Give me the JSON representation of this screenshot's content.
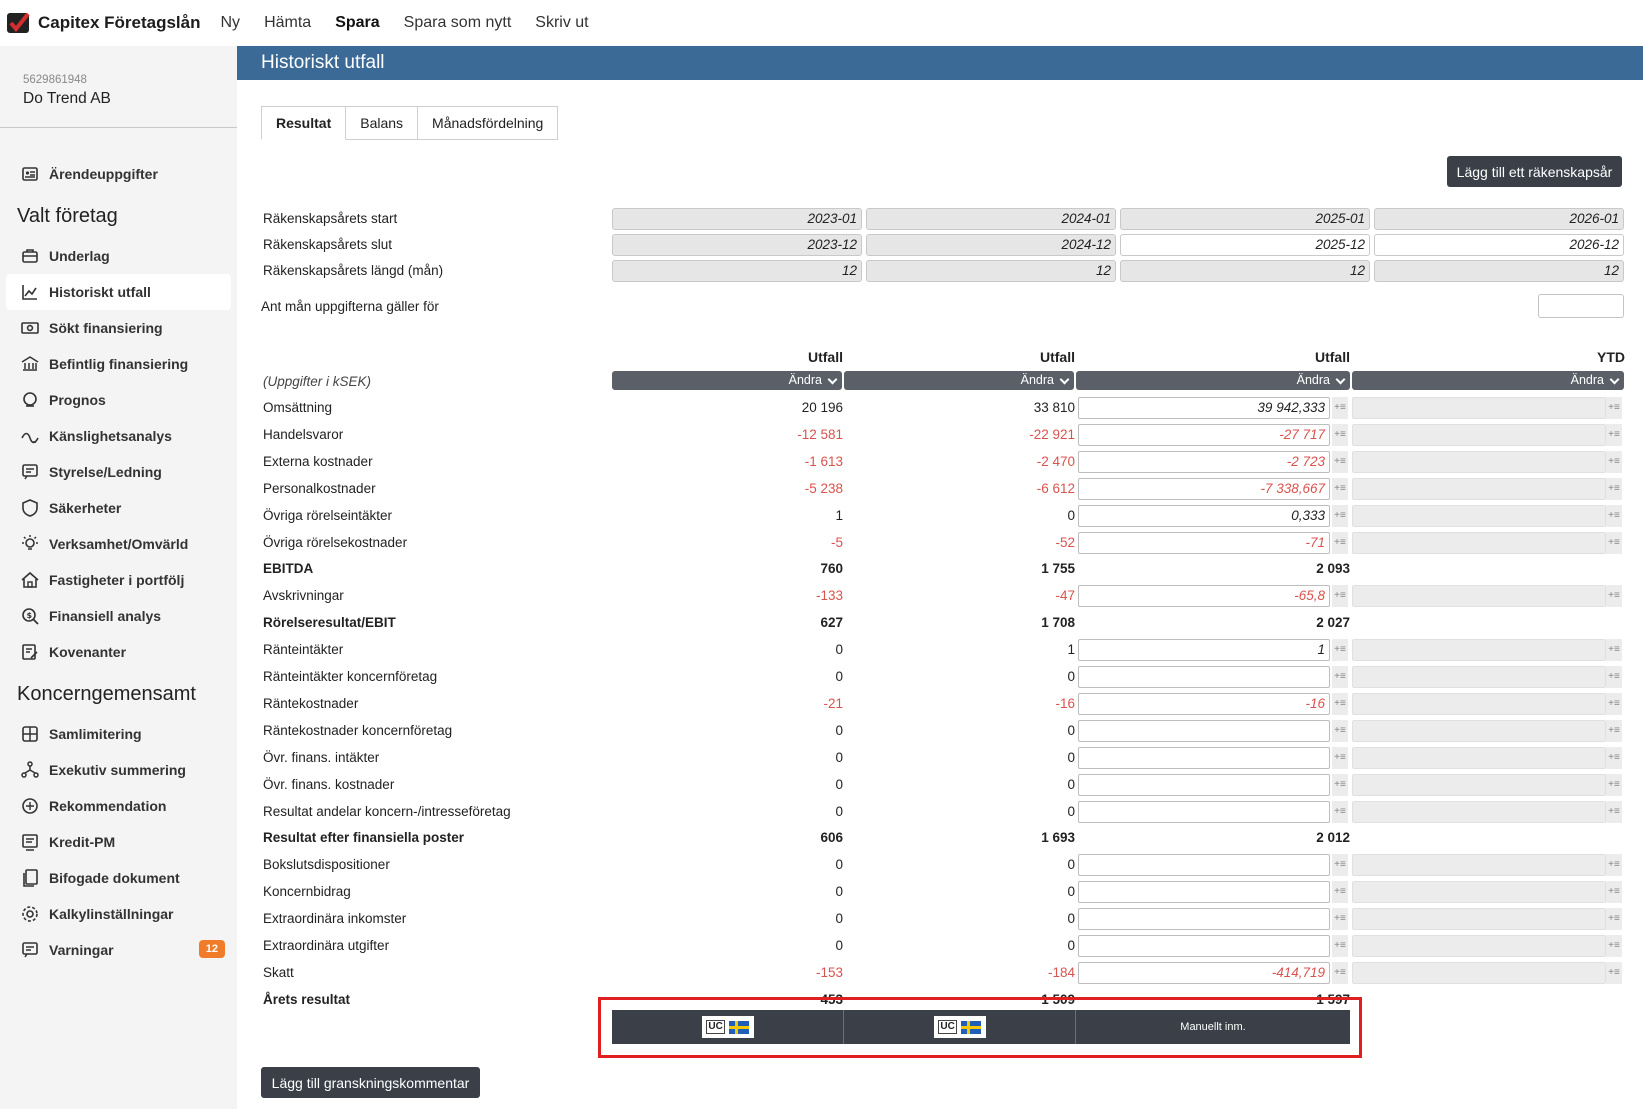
{
  "app": {
    "title": "Capitex Företagslån"
  },
  "topnav": [
    "Ny",
    "Hämta",
    "Spara",
    "Spara som nytt",
    "Skriv ut"
  ],
  "company": {
    "orgnr": "5629861948",
    "name": "Do Trend AB"
  },
  "sidebar": {
    "top_item": "Ärendeuppgifter",
    "section1": "Valt företag",
    "items1": [
      "Underlag",
      "Historiskt utfall",
      "Sökt finansiering",
      "Befintlig finansiering",
      "Prognos",
      "Känslighetsanalys",
      "Styrelse/Ledning",
      "Säkerheter",
      "Verksamhet/Omvärld",
      "Fastigheter i portfölj",
      "Finansiell analys",
      "Kovenanter"
    ],
    "section2": "Koncerngemensamt",
    "items2": [
      "Samlimitering",
      "Exekutiv summering",
      "Rekommendation",
      "Kredit-PM",
      "Bifogade dokument",
      "Kalkylinställningar",
      "Varningar"
    ],
    "warnings_count": "12"
  },
  "page": {
    "title": "Historiskt utfall",
    "tabs": [
      "Resultat",
      "Balans",
      "Månadsfördelning"
    ],
    "add_year_button": "Lägg till ett räkenskapsår",
    "add_comment_button": "Lägg till granskningskommentar",
    "months_label": "Ant mån uppgifterna gäller för",
    "units_label": "(Uppgifter i kSEK)",
    "change_label": "Ändra",
    "manual_label": "Manuellt inm."
  },
  "period": {
    "labels": [
      "Räkenskapsårets start",
      "Räkenskapsårets slut",
      "Räkenskapsårets längd (mån)"
    ],
    "start": [
      "2023-01",
      "2024-01",
      "2025-01",
      "2026-01"
    ],
    "end": [
      "2023-12",
      "2024-12",
      "2025-12",
      "2026-12"
    ],
    "length": [
      "12",
      "12",
      "12",
      "12"
    ]
  },
  "columns": [
    "Utfall",
    "Utfall",
    "Utfall",
    "YTD"
  ],
  "rows": [
    {
      "label": "Omsättning",
      "bold": false,
      "v": [
        "20 196",
        "33 810",
        "39 942,333"
      ]
    },
    {
      "label": "Handelsvaror",
      "bold": false,
      "v": [
        "-12 581",
        "-22 921",
        "-27 717"
      ]
    },
    {
      "label": "Externa kostnader",
      "bold": false,
      "v": [
        "-1 613",
        "-2 470",
        "-2 723"
      ]
    },
    {
      "label": "Personalkostnader",
      "bold": false,
      "v": [
        "-5 238",
        "-6 612",
        "-7 338,667"
      ]
    },
    {
      "label": "Övriga rörelseintäkter",
      "bold": false,
      "v": [
        "1",
        "0",
        "0,333"
      ]
    },
    {
      "label": "Övriga rörelsekostnader",
      "bold": false,
      "v": [
        "-5",
        "-52",
        "-71"
      ]
    },
    {
      "label": "EBITDA",
      "bold": true,
      "v": [
        "760",
        "1 755",
        "2 093"
      ]
    },
    {
      "label": "Avskrivningar",
      "bold": false,
      "v": [
        "-133",
        "-47",
        "-65,8"
      ]
    },
    {
      "label": "Rörelseresultat/EBIT",
      "bold": true,
      "v": [
        "627",
        "1 708",
        "2 027"
      ]
    },
    {
      "label": "Ränteintäkter",
      "bold": false,
      "v": [
        "0",
        "1",
        "1"
      ]
    },
    {
      "label": "Ränteintäkter koncernföretag",
      "bold": false,
      "v": [
        "0",
        "0",
        ""
      ]
    },
    {
      "label": "Räntekostnader",
      "bold": false,
      "v": [
        "-21",
        "-16",
        "-16"
      ]
    },
    {
      "label": "Räntekostnader koncernföretag",
      "bold": false,
      "v": [
        "0",
        "0",
        ""
      ]
    },
    {
      "label": "Övr. finans. intäkter",
      "bold": false,
      "v": [
        "0",
        "0",
        ""
      ]
    },
    {
      "label": "Övr. finans. kostnader",
      "bold": false,
      "v": [
        "0",
        "0",
        ""
      ]
    },
    {
      "label": "Resultat andelar koncern-/intresseföretag",
      "bold": false,
      "v": [
        "0",
        "0",
        ""
      ]
    },
    {
      "label": "Resultat efter finansiella poster",
      "bold": true,
      "v": [
        "606",
        "1 693",
        "2 012"
      ]
    },
    {
      "label": "Bokslutsdispositioner",
      "bold": false,
      "v": [
        "0",
        "0",
        ""
      ]
    },
    {
      "label": "Koncernbidrag",
      "bold": false,
      "v": [
        "0",
        "0",
        ""
      ]
    },
    {
      "label": "Extraordinära inkomster",
      "bold": false,
      "v": [
        "0",
        "0",
        ""
      ]
    },
    {
      "label": "Extraordinära utgifter",
      "bold": false,
      "v": [
        "0",
        "0",
        ""
      ]
    },
    {
      "label": "Skatt",
      "bold": false,
      "v": [
        "-153",
        "-184",
        "-414,719"
      ]
    },
    {
      "label": "Årets resultat",
      "bold": true,
      "v": [
        "453",
        "1 509",
        "1 597"
      ]
    }
  ]
}
